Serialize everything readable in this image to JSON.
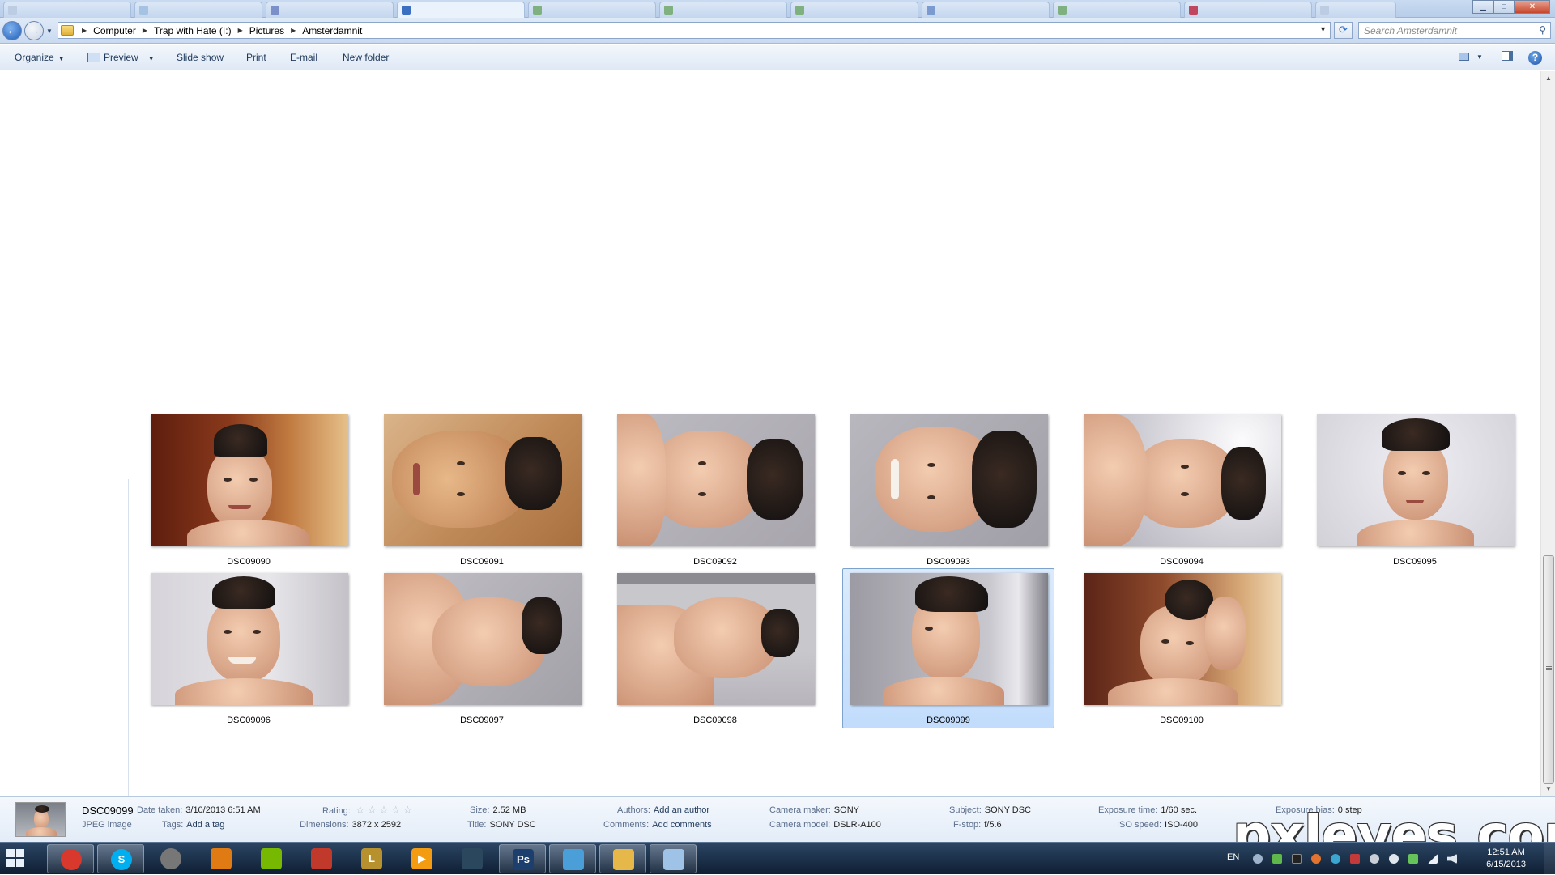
{
  "address": {
    "crumbs": [
      "Computer",
      "Trap with Hate (I:)",
      "Pictures",
      "Amsterdamnit"
    ],
    "search_placeholder": "Search Amsterdamnit"
  },
  "toolbar": {
    "organize": "Organize",
    "preview": "Preview",
    "slideshow": "Slide show",
    "print": "Print",
    "email": "E-mail",
    "new_folder": "New folder"
  },
  "files": [
    {
      "name": "DSC09090"
    },
    {
      "name": "DSC09091"
    },
    {
      "name": "DSC09092"
    },
    {
      "name": "DSC09093"
    },
    {
      "name": "DSC09094"
    },
    {
      "name": "DSC09095"
    },
    {
      "name": "DSC09096"
    },
    {
      "name": "DSC09097"
    },
    {
      "name": "DSC09098"
    },
    {
      "name": "DSC09099"
    },
    {
      "name": "DSC09100"
    }
  ],
  "selected_index": 9,
  "details": {
    "file_name": "DSC09099",
    "file_type": "JPEG image",
    "date_taken_label": "Date taken:",
    "date_taken": "3/10/2013 6:51 AM",
    "tags_label": "Tags:",
    "tags": "Add a tag",
    "rating_label": "Rating:",
    "rating_stars": 0,
    "dimensions_label": "Dimensions:",
    "dimensions": "3872 x 2592",
    "size_label": "Size:",
    "size": "2.52 MB",
    "title_label": "Title:",
    "title": "SONY DSC",
    "authors_label": "Authors:",
    "authors": "Add an author",
    "comments_label": "Comments:",
    "comments": "Add comments",
    "camera_maker_label": "Camera maker:",
    "camera_maker": "SONY",
    "camera_model_label": "Camera model:",
    "camera_model": "DSLR-A100",
    "subject_label": "Subject:",
    "subject": "SONY DSC",
    "fstop_label": "F-stop:",
    "fstop": "f/5.6",
    "exposure_time_label": "Exposure time:",
    "exposure_time": "1/60 sec.",
    "iso_label": "ISO speed:",
    "iso": "ISO-400",
    "exposure_bias_label": "Exposure bias:",
    "exposure_bias": "0 step"
  },
  "taskbar": {
    "apps": [
      {
        "icon": "chrome-icon",
        "glyph": "",
        "color": "#d9382c",
        "open": true
      },
      {
        "icon": "skype-icon",
        "glyph": "S",
        "color": "#00aff0",
        "open": true
      },
      {
        "icon": "steering-wheel-icon",
        "glyph": "",
        "color": "#777777",
        "open": false
      },
      {
        "icon": "winamp-icon",
        "glyph": "",
        "color": "#e07a12",
        "open": false
      },
      {
        "icon": "nvidia-icon",
        "glyph": "",
        "color": "#76b900",
        "open": false
      },
      {
        "icon": "shield-game-icon",
        "glyph": "",
        "color": "#c0392b",
        "open": false
      },
      {
        "icon": "league-of-legends-icon",
        "glyph": "L",
        "color": "#b8912f",
        "open": false
      },
      {
        "icon": "media-player-icon",
        "glyph": "▶",
        "color": "#f39c12",
        "open": false
      },
      {
        "icon": "steam-icon",
        "glyph": "",
        "color": "#2a475e",
        "open": false
      },
      {
        "icon": "photoshop-icon",
        "glyph": "Ps",
        "color": "#1c3f6e",
        "open": true
      },
      {
        "icon": "monitor-app-icon",
        "glyph": "",
        "color": "#4a9fd8",
        "open": true
      },
      {
        "icon": "explorer-folder-icon",
        "glyph": "",
        "color": "#e6b84a",
        "open": true
      },
      {
        "icon": "paint-icon",
        "glyph": "",
        "color": "#9fc3e6",
        "open": true
      }
    ],
    "language": "EN",
    "time": "12:51 AM",
    "date": "6/15/2013"
  },
  "watermark": "pxleyes.com",
  "colors": {
    "selection": "#c1dcfc",
    "selection_border": "#7da2ce",
    "taskbar": "#1b2f48"
  }
}
